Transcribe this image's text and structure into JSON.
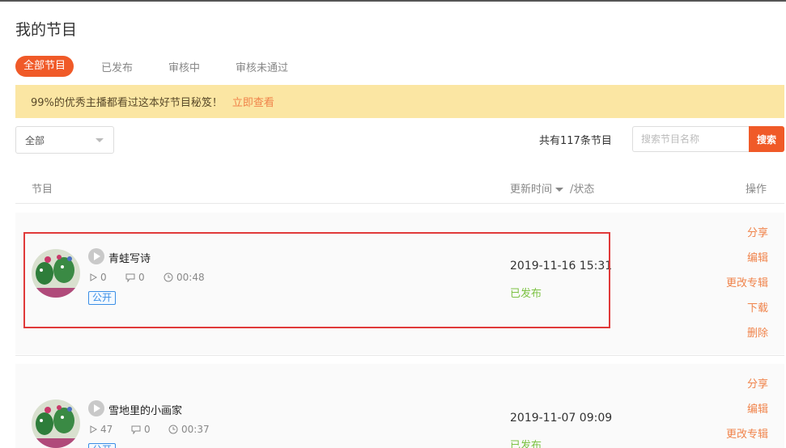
{
  "page": {
    "title": "我的节目"
  },
  "tabs": [
    {
      "label": "全部节目",
      "active": true
    },
    {
      "label": "已发布",
      "active": false
    },
    {
      "label": "审核中",
      "active": false
    },
    {
      "label": "审核未通过",
      "active": false
    }
  ],
  "notice": {
    "text": "99%的优秀主播都看过这本好节目秘笈！",
    "link": "立即查看"
  },
  "filter": {
    "selected": "全部"
  },
  "summary": {
    "total_text": "共有117条节目"
  },
  "search": {
    "placeholder": "搜索节目名称",
    "button": "搜索"
  },
  "table": {
    "headers": {
      "program": "节目",
      "update_time": "更新时间",
      "status": "/状态",
      "action": "操作"
    }
  },
  "rows": [
    {
      "title": "青蛙写诗",
      "plays": "0",
      "comments": "0",
      "duration": "00:48",
      "tag": "公开",
      "date": "2019-11-16 15:31",
      "status": "已发布",
      "actions": [
        "分享",
        "编辑",
        "更改专辑",
        "下载",
        "删除"
      ]
    },
    {
      "title": "雪地里的小画家",
      "plays": "47",
      "comments": "0",
      "duration": "00:37",
      "tag": "公开",
      "date": "2019-11-07 09:09",
      "status": "已发布",
      "actions": [
        "分享",
        "编辑",
        "更改专辑"
      ]
    }
  ],
  "colors": {
    "accent": "#f05a28",
    "published": "#7cc243",
    "link": "#f0834a",
    "tag": "#3a8ee6",
    "highlight_box": "#e03a3a"
  }
}
